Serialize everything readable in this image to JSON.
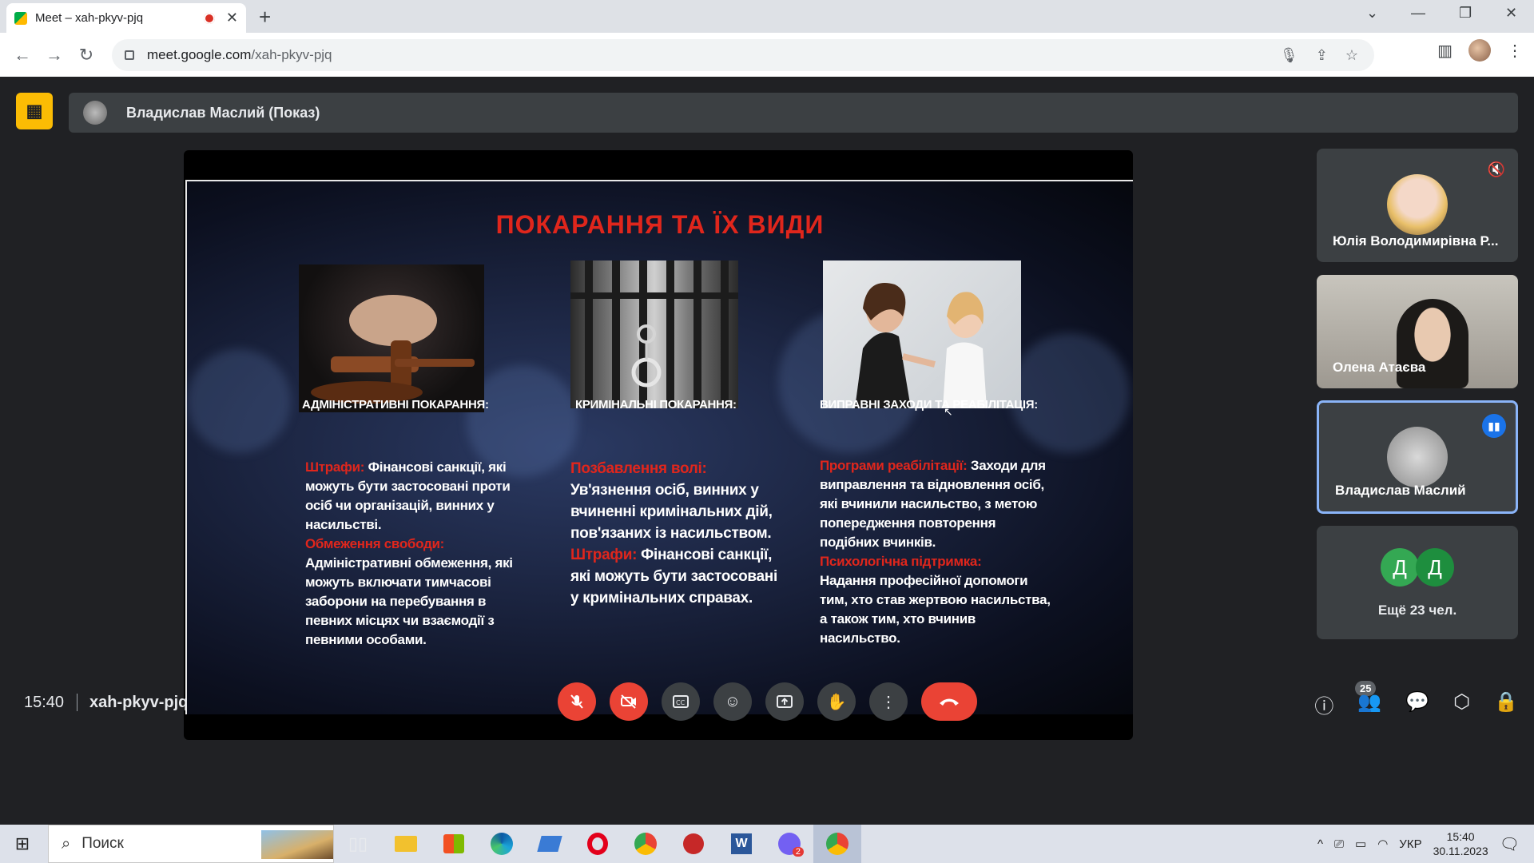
{
  "browser": {
    "tab_title": "Meet – xah-pkyv-pjq",
    "new_tab": "+",
    "url_host": "meet.google.com",
    "url_path": "/xah-pkyv-pjq"
  },
  "presenter": {
    "label": "Владислав Маслий (Показ)"
  },
  "slide": {
    "title": "ПОКАРАННЯ ТА ЇХ ВИДИ",
    "columns": [
      {
        "heading": "АДМІНІСТРАТИВНІ ПОКАРАННЯ:",
        "term1": "Штрафи:",
        "text1": " Фінансові санкції, які можуть бути застосовані проти осіб чи організацій, винних у насильстві.",
        "term2": "Обмеження свободи:",
        "text2": "Адміністративні обмеження, які можуть включати тимчасові заборони на перебування в певних місцях чи взаємодії з певними особами."
      },
      {
        "heading": "КРИМІНАЛЬНІ ПОКАРАННЯ:",
        "term1": "Позбавлення волі:",
        "text1": "Ув'язнення осіб, винних у вчиненні кримінальних дій, пов'язаних із насильством.",
        "term2": "Штрафи:",
        "text2": " Фінансові санкції, які можуть бути застосовані у кримінальних справах."
      },
      {
        "heading": "ВИПРАВНІ ЗАХОДИ ТА РЕАБІЛІТАЦІЯ:",
        "term1": "Програми реабілітації:",
        "text1": " Заходи для виправлення та відновлення осіб, які вчинили насильство, з метою попередження повторення подібних вчинків.",
        "term2": "Психологічна підтримка:",
        "text2": "Надання професійної допомоги тим, хто став жертвою насильства, а також тим, хто вчинив насильство."
      }
    ]
  },
  "participants": [
    {
      "name": "Юлія Володимирівна Р...",
      "muted": true
    },
    {
      "name": "Олена Атаєва"
    },
    {
      "name": "Владислав Маслий",
      "speaking": true
    }
  ],
  "more": {
    "initials": [
      "Д",
      "Д"
    ],
    "colors": [
      "#34a853",
      "#1e8e3e"
    ],
    "label": "Ещё 23 чел."
  },
  "bottom_bar": {
    "time": "15:40",
    "meeting_code": "xah-pkyv-pjq",
    "people_count": "25"
  },
  "taskbar": {
    "search_placeholder": "Поиск",
    "chat_badge": "2",
    "lang": "УКР",
    "clock_time": "15:40",
    "clock_date": "30.11.2023"
  }
}
